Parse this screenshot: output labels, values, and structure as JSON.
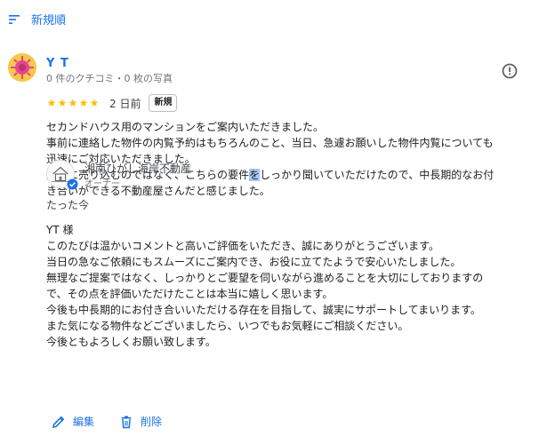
{
  "sort": {
    "label": "新規順",
    "icon": "sort-icon"
  },
  "review": {
    "reviewer_name": "Y T",
    "reviewer_meta": "0 件のクチコミ・0 枚の写真",
    "rating": 5,
    "stars": [
      "★",
      "★",
      "★",
      "★",
      "★"
    ],
    "date": "2 日前",
    "badge": "新規",
    "lines": [
      "セカンドハウス用のマンションをご案内いただきました。",
      "事前に連絡した物件の内覧予約はもちろんのこと、当日、急遽お願いした物件内覧についても",
      "迅速にご対応いただきました。"
    ],
    "line4_pre": "無理に売り込むのではなく、こちらの要件",
    "line4_hl": "を",
    "line4_post": "しっかり聞いていただけたので、中長期的なお付",
    "line5": "き合いができる不動産屋さんだと感じました。",
    "colors": {
      "accent": "#1a73e8",
      "star": "#fbbc04"
    }
  },
  "owner": {
    "name": "湘南ひがし海岸不動産",
    "role": "オーナー",
    "reply_time": "たった今",
    "reply_lines": [
      "YT 様",
      "このたびは温かいコメントと高いご評価をいただき、誠にありがとうございます。",
      "当日の急なご依頼にもスムーズにご案内でき、お役に立てたようで安心いたしました。",
      "無理なご提案ではなく、しっかりとご要望を伺いながら進めることを大切にしておりますの",
      "で、その点を評価いただけたことは本当に嬉しく思います。",
      "今後も中長期的にお付き合いいただける存在を目指して、誠実にサポートしてまいります。",
      "また気になる物件などございましたら、いつでもお気軽にご相談ください。",
      "今後ともよろしくお願い致します。"
    ]
  },
  "actions": {
    "edit_label": "編集",
    "delete_label": "削除"
  }
}
